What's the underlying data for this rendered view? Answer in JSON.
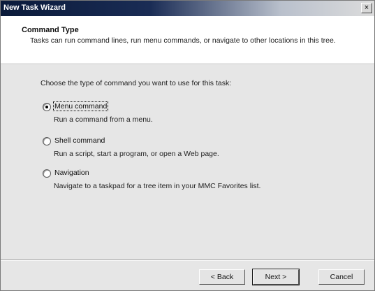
{
  "window": {
    "title": "New Task Wizard",
    "close_label": "×"
  },
  "header": {
    "title": "Command Type",
    "description": "Tasks can run command lines, run menu commands, or navigate to other locations in this tree."
  },
  "prompt": "Choose the type of command you want to use for this task:",
  "options": [
    {
      "label": "Menu command",
      "description": "Run a command from a menu.",
      "selected": true
    },
    {
      "label": "Shell command",
      "description": "Run a script, start a program, or open a Web page.",
      "selected": false
    },
    {
      "label": "Navigation",
      "description": "Navigate to a taskpad for a tree item in your MMC Favorites list.",
      "selected": false
    }
  ],
  "buttons": {
    "back": "< Back",
    "next": "Next >",
    "cancel": "Cancel"
  }
}
